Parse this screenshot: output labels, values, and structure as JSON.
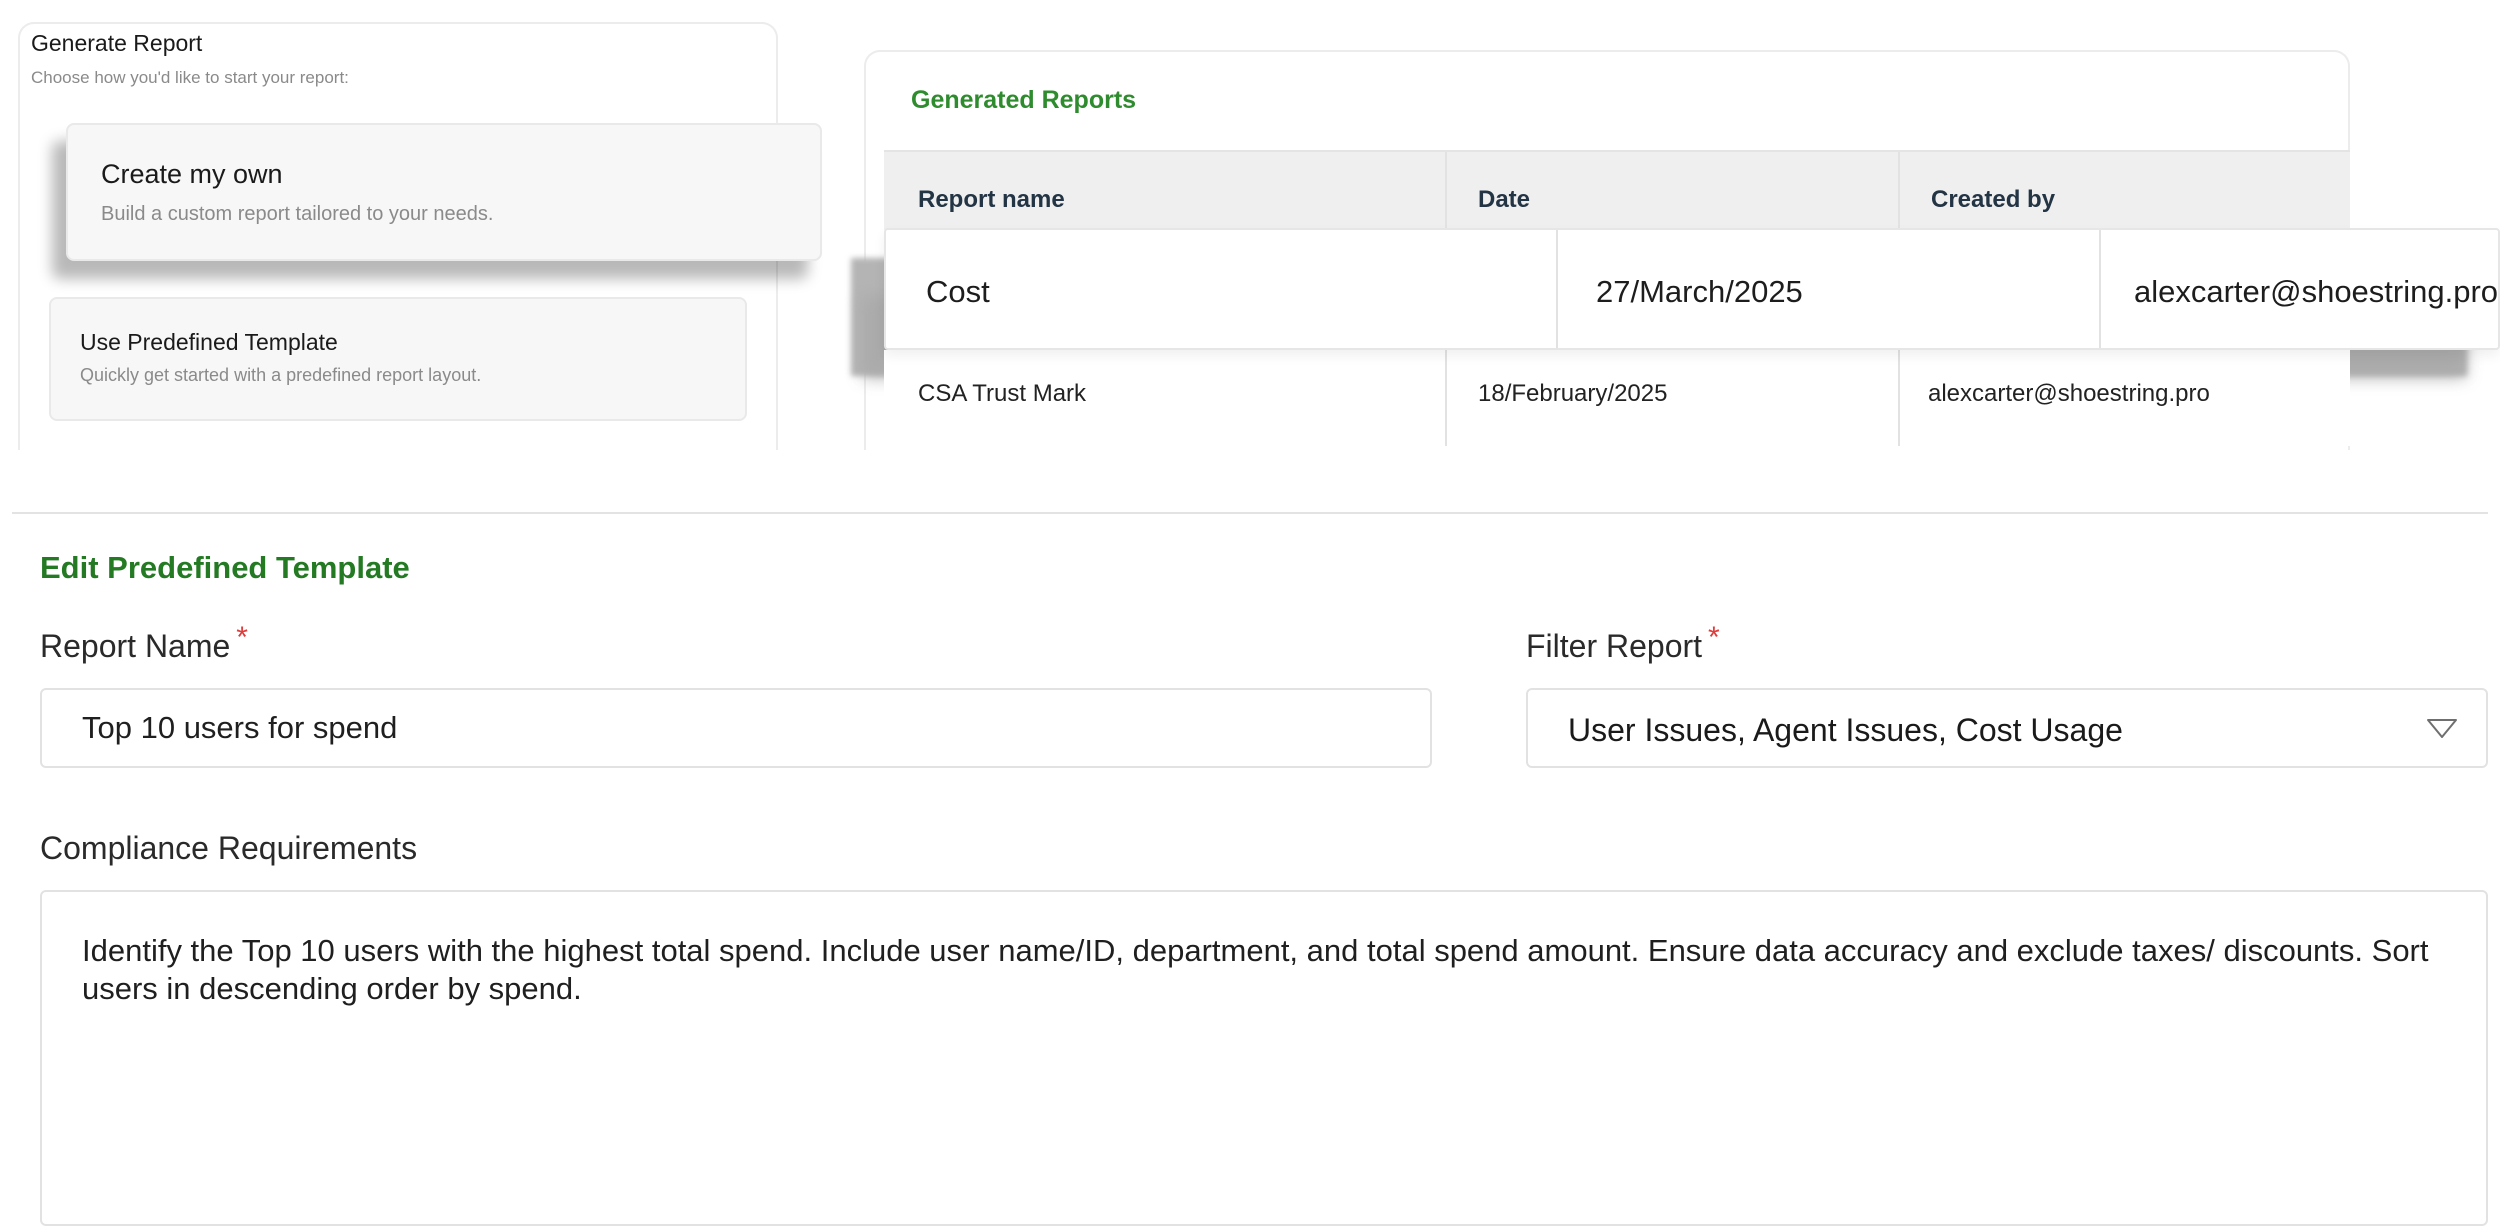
{
  "generate_report": {
    "title": "Generate Report",
    "subtitle": "Choose how you'd like to start your report:",
    "options": [
      {
        "title": "Create my own",
        "description": "Build a custom report tailored to your needs."
      },
      {
        "title": "Use Predefined Template",
        "description": "Quickly get started with a predefined report layout."
      }
    ]
  },
  "generated_reports": {
    "title": "Generated Reports",
    "columns": [
      "Report name",
      "Date",
      "Created by"
    ],
    "rows": [
      {
        "name": "Cost",
        "date": "27/March/2025",
        "created_by": "alexcarter@shoestring.pro"
      },
      {
        "name": "CSA Trust Mark",
        "date": "18/February/2025",
        "created_by": "alexcarter@shoestring.pro"
      }
    ]
  },
  "edit_template": {
    "title": "Edit Predefined Template",
    "report_name": {
      "label": "Report Name",
      "required_mark": "*",
      "value": "Top 10 users for spend"
    },
    "filter_report": {
      "label": "Filter Report",
      "required_mark": "*",
      "value": "User Issues, Agent Issues, Cost Usage"
    },
    "compliance": {
      "label": "Compliance Requirements",
      "value": "Identify the Top 10 users with the highest total spend. Include user name/ID, department, and total spend amount. Ensure data accuracy and exclude taxes/ discounts. Sort users in descending order by spend."
    }
  },
  "colors": {
    "accent_green": "#2e8b2e",
    "required_red": "#e03b3b",
    "header_text": "#233445"
  },
  "icons": {
    "filter_dropdown": "chevron-down-icon"
  }
}
